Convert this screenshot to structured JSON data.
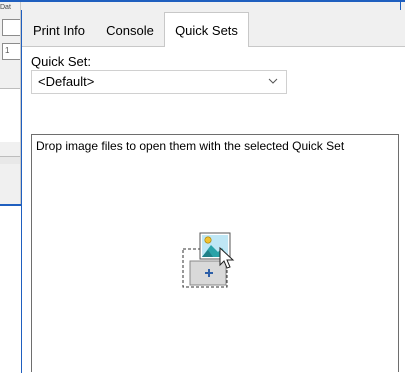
{
  "background_window": {
    "clipped_label": "Dat"
  },
  "tabs": [
    {
      "label": "Print Info",
      "selected": false
    },
    {
      "label": "Console",
      "selected": false
    },
    {
      "label": "Quick Sets",
      "selected": true
    }
  ],
  "quick_set": {
    "label": "Quick Set:",
    "selected_value": "<Default>"
  },
  "drop_zone": {
    "hint": "Drop image files to open them with the selected Quick Set",
    "icon": "drop-image-icon"
  },
  "colors": {
    "window_border": "#1f5fbf",
    "panel_background": "#f0f0f0",
    "content_background": "#ffffff",
    "icon_accent": "#2aa3a8"
  }
}
